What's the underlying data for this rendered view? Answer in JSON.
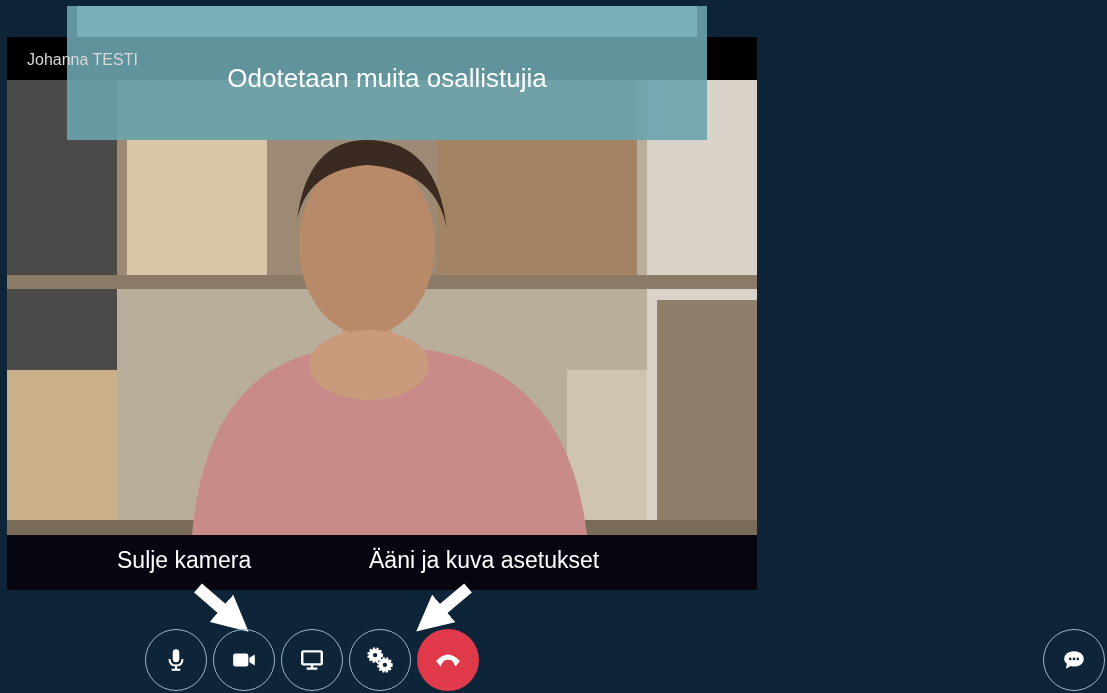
{
  "participant_name": "Johanna TESTI",
  "status_message": "Odotetaan muita osallistujia",
  "annotations": [
    {
      "text": "Sulje kamera",
      "kind": "arrow-down-right"
    },
    {
      "text": "Ääni ja kuva asetukset",
      "kind": "arrow-down-left"
    }
  ],
  "controls": [
    {
      "kind": "microphone"
    },
    {
      "kind": "camera"
    },
    {
      "kind": "screen"
    },
    {
      "kind": "settings"
    },
    {
      "kind": "hangup"
    }
  ],
  "chat_button": {
    "kind": "chat"
  }
}
